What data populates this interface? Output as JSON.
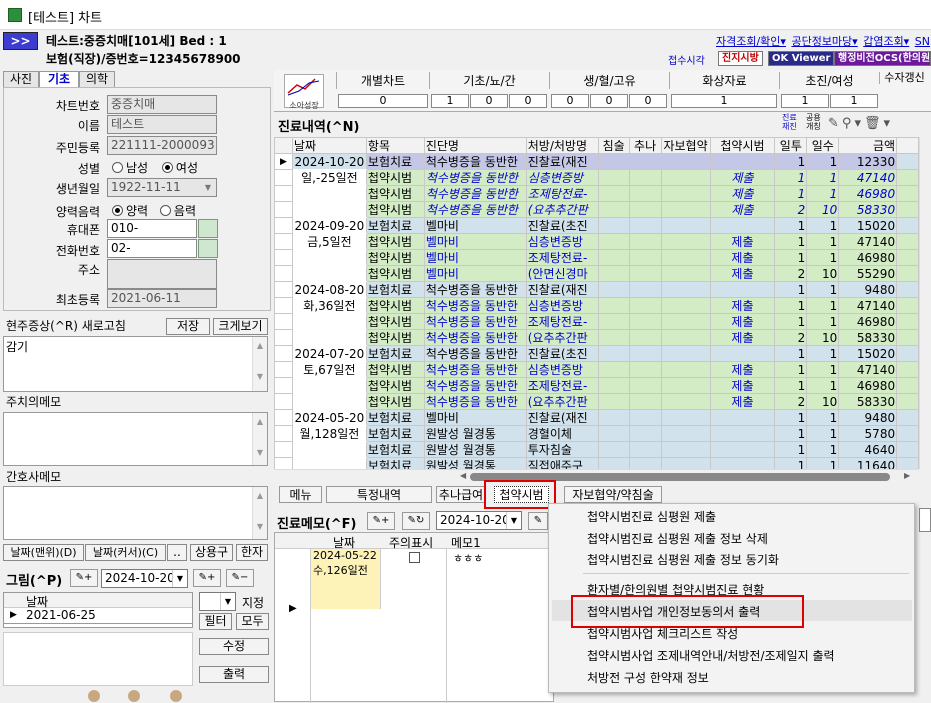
{
  "window": {
    "title": "[테스트] 차트"
  },
  "patient": {
    "line1": "테스트:중증치매[101세]   Bed : 1",
    "line2": "보험(직장)/증번호=12345678900",
    "arrow": ">>"
  },
  "toplinks": [
    "자격조회/확인▾",
    "공단정보마당▾",
    "갑염조회▾",
    "SN"
  ],
  "navbar": {
    "time_label": "접수시각",
    "b1": "진지시방",
    "b2": "OK Viewer",
    "b3": "행정비전OCS(한의원)"
  },
  "lefttabs": [
    "사진",
    "기초",
    "의학"
  ],
  "fields": [
    {
      "label": "차트번호",
      "value": "중증치매"
    },
    {
      "label": "이름",
      "value": "테스트"
    },
    {
      "label": "주민등록",
      "value": "221111-2000093"
    },
    {
      "label": "성별",
      "value": ""
    },
    {
      "label": "생년월일",
      "value": "1922-11-11"
    },
    {
      "label": "양력음력",
      "value": ""
    },
    {
      "label": "휴대폰",
      "value": "010-"
    },
    {
      "label": "전화번호",
      "value": "02-"
    },
    {
      "label": "주소",
      "value": ""
    },
    {
      "label": "최초등록",
      "value": "2021-06-11"
    }
  ],
  "gender": {
    "male": "남성",
    "female": "여성"
  },
  "calendar": {
    "solar": "양력",
    "lunar": "음력"
  },
  "symptom": {
    "label": "현주증상(^R) 새로고침",
    "save": "저장",
    "enlarge": "크게보기",
    "text": "감기"
  },
  "doctor_memo": {
    "label": "주치의메모"
  },
  "nurse_memo": {
    "label": "간호사메모"
  },
  "datebtns": [
    "날짜(맨위)(D)",
    "날짜(커서)(C)",
    "..",
    "상용구",
    "한자"
  ],
  "picture": {
    "label": "그림(^P)",
    "date": "2024-10-20",
    "col": "날짜",
    "row": "2021-06-25",
    "assign": "지정",
    "filter": "필터",
    "all": "모두",
    "edit": "수정",
    "print": "출력"
  },
  "header_cats": [
    {
      "label": "개별차트",
      "vals": [
        "0"
      ]
    },
    {
      "label": "기초/뇨/간",
      "vals": [
        "1",
        "0",
        "0"
      ]
    },
    {
      "label": "생/혈/고유",
      "vals": [
        "0",
        "0",
        "0"
      ]
    },
    {
      "label": "화상자료",
      "vals": [
        "1"
      ]
    },
    {
      "label": "초진/여성",
      "vals": [
        "1",
        "1"
      ]
    }
  ],
  "header_side": {
    "chart_label": "소아성장",
    "extra": "수자갱신"
  },
  "records": {
    "title": "진료내역(^N)",
    "tools": [
      "진료재진",
      "공용개칭"
    ],
    "columns": [
      "날짜",
      "항목",
      "진단명",
      "처방/처방명",
      "침술",
      "추나",
      "자보협약",
      "첩약시범",
      "일투",
      "일수",
      "금액"
    ],
    "rows": [
      {
        "date": "2024-10-20",
        "type": "보험치료",
        "diag": "척수병증을 동반한",
        "rx": "진찰료(재진",
        "cheop": "",
        "d1": "1",
        "d2": "1",
        "amt": "12330",
        "style": "b",
        "sel": true
      },
      {
        "date": "일,-25일전",
        "type": "첩약시범",
        "diag": "척수병증을 동반한",
        "rx": "심층변증방",
        "cheop": "제출",
        "d1": "1",
        "d2": "1",
        "amt": "47140",
        "style": "gi"
      },
      {
        "date": "",
        "type": "첩약시범",
        "diag": "척수병증을 동반한",
        "rx": "조제탕전료-",
        "cheop": "제출",
        "d1": "1",
        "d2": "1",
        "amt": "46980",
        "style": "gi"
      },
      {
        "date": "",
        "type": "첩약시범",
        "diag": "척수병증을 동반한",
        "rx": "(요추추간판",
        "cheop": "제출",
        "d1": "2",
        "d2": "10",
        "amt": "58330",
        "style": "gi"
      },
      {
        "date": "2024-09-20",
        "type": "보험치료",
        "diag": "벨마비",
        "rx": "진찰료(초진",
        "cheop": "",
        "d1": "1",
        "d2": "1",
        "amt": "15020",
        "style": "b"
      },
      {
        "date": "금,5일전",
        "type": "첩약시범",
        "diag": "벨마비",
        "rx": "심층변증방",
        "cheop": "제출",
        "d1": "1",
        "d2": "1",
        "amt": "47140",
        "style": "g"
      },
      {
        "date": "",
        "type": "첩약시범",
        "diag": "벨마비",
        "rx": "조제탕전료-",
        "cheop": "제출",
        "d1": "1",
        "d2": "1",
        "amt": "46980",
        "style": "g"
      },
      {
        "date": "",
        "type": "첩약시범",
        "diag": "벨마비",
        "rx": "(안면신경마",
        "cheop": "제출",
        "d1": "2",
        "d2": "10",
        "amt": "55290",
        "style": "g"
      },
      {
        "date": "2024-08-20",
        "type": "보험치료",
        "diag": "척수병증을 동반한",
        "rx": "진찰료(재진",
        "cheop": "",
        "d1": "1",
        "d2": "1",
        "amt": "9480",
        "style": "b"
      },
      {
        "date": "화,36일전",
        "type": "첩약시범",
        "diag": "척수병증을 동반한",
        "rx": "심층변증방",
        "cheop": "제출",
        "d1": "1",
        "d2": "1",
        "amt": "47140",
        "style": "g"
      },
      {
        "date": "",
        "type": "첩약시범",
        "diag": "척수병증을 동반한",
        "rx": "조제탕전료-",
        "cheop": "제출",
        "d1": "1",
        "d2": "1",
        "amt": "46980",
        "style": "g"
      },
      {
        "date": "",
        "type": "첩약시범",
        "diag": "척수병증을 동반한",
        "rx": "(요추추간판",
        "cheop": "제출",
        "d1": "2",
        "d2": "10",
        "amt": "58330",
        "style": "g"
      },
      {
        "date": "2024-07-20",
        "type": "보험치료",
        "diag": "척수병증을 동반한",
        "rx": "진찰료(초진",
        "cheop": "",
        "d1": "1",
        "d2": "1",
        "amt": "15020",
        "style": "b"
      },
      {
        "date": "토,67일전",
        "type": "첩약시범",
        "diag": "척수병증을 동반한",
        "rx": "심층변증방",
        "cheop": "제출",
        "d1": "1",
        "d2": "1",
        "amt": "47140",
        "style": "g"
      },
      {
        "date": "",
        "type": "첩약시범",
        "diag": "척수병증을 동반한",
        "rx": "조제탕전료-",
        "cheop": "제출",
        "d1": "1",
        "d2": "1",
        "amt": "46980",
        "style": "g"
      },
      {
        "date": "",
        "type": "첩약시범",
        "diag": "척수병증을 동반한",
        "rx": "(요추추간판",
        "cheop": "제출",
        "d1": "2",
        "d2": "10",
        "amt": "58330",
        "style": "g"
      },
      {
        "date": "2024-05-20",
        "type": "보험치료",
        "diag": "벨마비",
        "rx": "진찰료(재진",
        "cheop": "",
        "d1": "1",
        "d2": "1",
        "amt": "9480",
        "style": "b"
      },
      {
        "date": "월,128일전",
        "type": "보험치료",
        "diag": "원발성 월경통",
        "rx": "경혈이체",
        "cheop": "",
        "d1": "1",
        "d2": "1",
        "amt": "5780",
        "style": "b"
      },
      {
        "date": "",
        "type": "보험치료",
        "diag": "원발성 월경통",
        "rx": "투자침술",
        "cheop": "",
        "d1": "1",
        "d2": "1",
        "amt": "4640",
        "style": "b"
      },
      {
        "date": "",
        "type": "보험치료",
        "diag": "원발성 월경통",
        "rx": "직접애주구",
        "cheop": "",
        "d1": "1",
        "d2": "1",
        "amt": "11640",
        "style": "b"
      }
    ]
  },
  "bottom_tabs": [
    "메뉴",
    "특정내역",
    "추나급여",
    "첩약시범",
    "자보협약/약침술"
  ],
  "memo": {
    "title": "진료메모(^F)",
    "date": "2024-10-20",
    "cols": [
      "날짜",
      "주의표시",
      "메모1"
    ],
    "row_date": "2024-05-22",
    "row_sub": "수,126일전",
    "row_memo": "ㅎㅎㅎ"
  },
  "context_menu": [
    "첩약시범진료 심평원 제출",
    "첩약시범진료 심평원 제출 정보 삭제",
    "첩약시범진료 심평원 제출 정보 동기화",
    "환자별/한의원별 첩약시범진료 현황",
    "첩약시범사업 개인정보동의서 출력",
    "첩약시범사업 체크리스트 작성",
    "첩약시범사업 조제내역안내/처방전/조제일지 출력",
    "처방전 구성 한약재 정보"
  ]
}
